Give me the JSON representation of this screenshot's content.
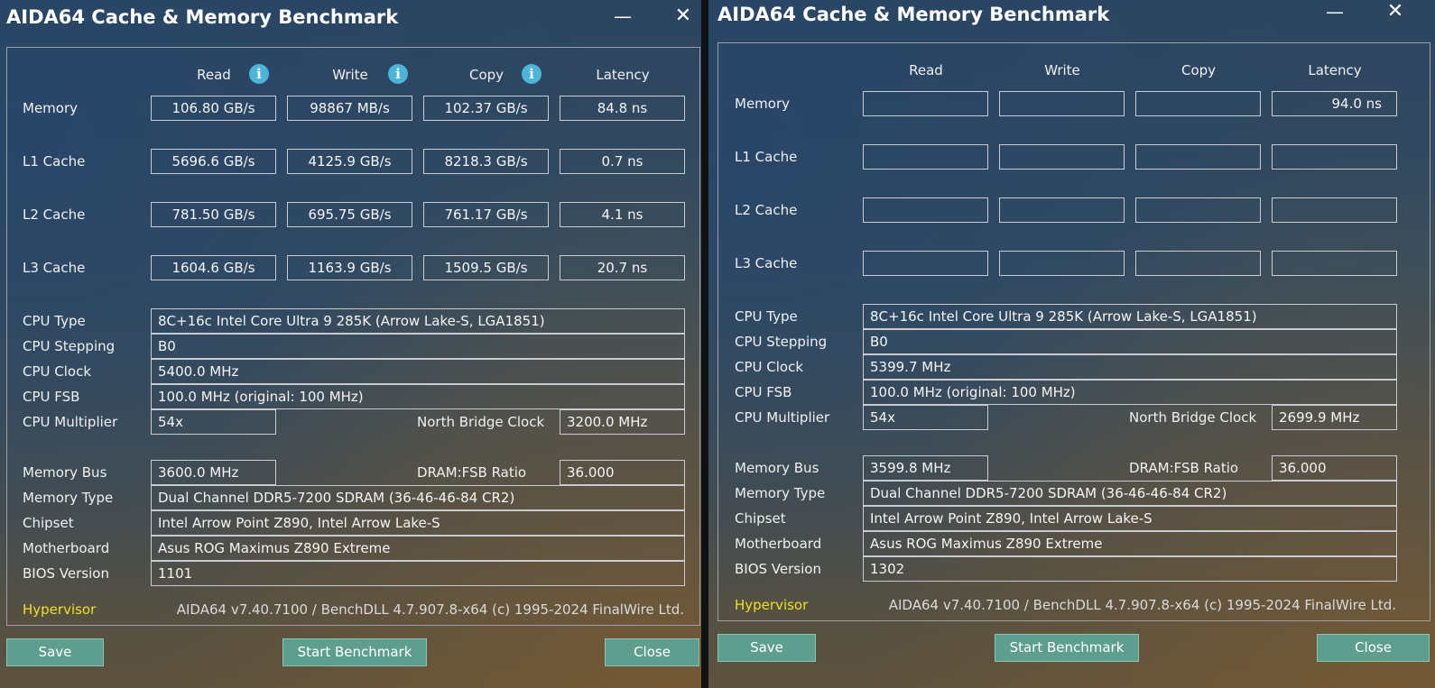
{
  "left": {
    "title": "AIDA64 Cache & Memory Benchmark",
    "window_controls": {
      "minimize": "—",
      "close": "✕"
    },
    "headers": {
      "read": "Read",
      "write": "Write",
      "copy": "Copy",
      "latency": "Latency"
    },
    "rows": [
      {
        "label": "Memory",
        "read": "106.80 GB/s",
        "write": "98867 MB/s",
        "copy": "102.37 GB/s",
        "latency": "84.8 ns"
      },
      {
        "label": "L1 Cache",
        "read": "5696.6 GB/s",
        "write": "4125.9 GB/s",
        "copy": "8218.3 GB/s",
        "latency": "0.7 ns"
      },
      {
        "label": "L2 Cache",
        "read": "781.50 GB/s",
        "write": "695.75 GB/s",
        "copy": "761.17 GB/s",
        "latency": "4.1 ns"
      },
      {
        "label": "L3 Cache",
        "read": "1604.6 GB/s",
        "write": "1163.9 GB/s",
        "copy": "1509.5 GB/s",
        "latency": "20.7 ns"
      }
    ],
    "cpu": {
      "type_label": "CPU Type",
      "type": "8C+16c Intel Core Ultra 9 285K  (Arrow Lake-S, LGA1851)",
      "stepping_label": "CPU Stepping",
      "stepping": "B0",
      "clock_label": "CPU Clock",
      "clock": "5400.0 MHz",
      "fsb_label": "CPU FSB",
      "fsb": "100.0 MHz  (original: 100 MHz)",
      "multiplier_label": "CPU Multiplier",
      "multiplier": "54x",
      "nb_clock_label": "North Bridge Clock",
      "nb_clock": "3200.0 MHz"
    },
    "mem": {
      "bus_label": "Memory Bus",
      "bus": "3600.0 MHz",
      "ratio_label": "DRAM:FSB Ratio",
      "ratio": "36.000",
      "type_label": "Memory Type",
      "type": "Dual Channel DDR5-7200 SDRAM  (36-46-46-84 CR2)",
      "chipset_label": "Chipset",
      "chipset": "Intel Arrow Point Z890, Intel Arrow Lake-S",
      "mobo_label": "Motherboard",
      "mobo": "Asus ROG Maximus Z890 Extreme",
      "bios_label": "BIOS Version",
      "bios": "1101"
    },
    "hypervisor": "Hypervisor",
    "copyright": "AIDA64 v7.40.7100 / BenchDLL 4.7.907.8-x64  (c) 1995-2024 FinalWire Ltd.",
    "buttons": {
      "save": "Save",
      "start": "Start Benchmark",
      "close": "Close"
    }
  },
  "right": {
    "title": "AIDA64 Cache & Memory Benchmark",
    "window_controls": {
      "minimize": "—",
      "close": "✕"
    },
    "headers": {
      "read": "Read",
      "write": "Write",
      "copy": "Copy",
      "latency": "Latency"
    },
    "rows": [
      {
        "label": "Memory",
        "read": "",
        "write": "",
        "copy": "",
        "latency": "94.0 ns"
      },
      {
        "label": "L1 Cache",
        "read": "",
        "write": "",
        "copy": "",
        "latency": ""
      },
      {
        "label": "L2 Cache",
        "read": "",
        "write": "",
        "copy": "",
        "latency": ""
      },
      {
        "label": "L3 Cache",
        "read": "",
        "write": "",
        "copy": "",
        "latency": ""
      }
    ],
    "cpu": {
      "type_label": "CPU Type",
      "type": "8C+16c Intel Core Ultra 9 285K  (Arrow Lake-S, LGA1851)",
      "stepping_label": "CPU Stepping",
      "stepping": "B0",
      "clock_label": "CPU Clock",
      "clock": "5399.7 MHz",
      "fsb_label": "CPU FSB",
      "fsb": "100.0 MHz  (original: 100 MHz)",
      "multiplier_label": "CPU Multiplier",
      "multiplier": "54x",
      "nb_clock_label": "North Bridge Clock",
      "nb_clock": "2699.9 MHz"
    },
    "mem": {
      "bus_label": "Memory Bus",
      "bus": "3599.8 MHz",
      "ratio_label": "DRAM:FSB Ratio",
      "ratio": "36.000",
      "type_label": "Memory Type",
      "type": "Dual Channel DDR5-7200 SDRAM  (36-46-46-84 CR2)",
      "chipset_label": "Chipset",
      "chipset": "Intel Arrow Point Z890, Intel Arrow Lake-S",
      "mobo_label": "Motherboard",
      "mobo": "Asus ROG Maximus Z890 Extreme",
      "bios_label": "BIOS Version",
      "bios": "1302"
    },
    "hypervisor": "Hypervisor",
    "copyright": "AIDA64 v7.40.7100 / BenchDLL 4.7.907.8-x64  (c) 1995-2024 FinalWire Ltd.",
    "buttons": {
      "save": "Save",
      "start": "Start Benchmark",
      "close": "Close"
    }
  }
}
